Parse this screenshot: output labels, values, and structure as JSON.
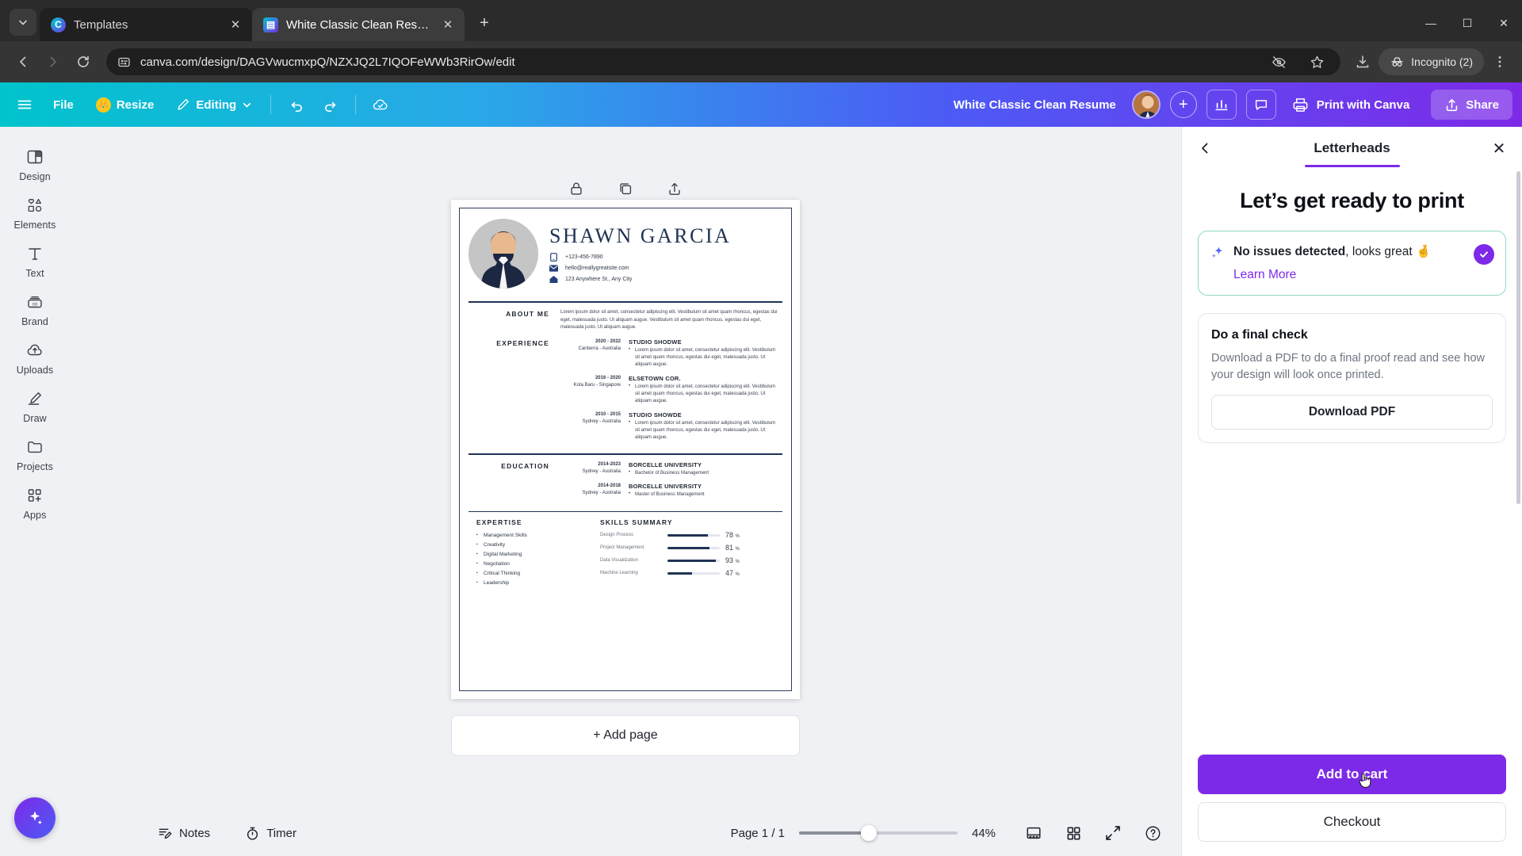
{
  "browser": {
    "tabs": [
      {
        "title": "Templates",
        "favicon": "canva-icon",
        "active": false
      },
      {
        "title": "White Classic Clean Resume - A",
        "favicon": "canva-doc-icon",
        "active": true
      }
    ],
    "url": "canva.com/design/DAGVwucmxpQ/NZXJQ2L7IQOFeWWb3RirOw/edit",
    "profile_label": "Incognito (2)",
    "new_tab_label": "+",
    "window": {
      "minimize": "—",
      "maximize": "☐",
      "close": "✕"
    }
  },
  "canva_header": {
    "file_label": "File",
    "resize_label": "Resize",
    "editing_label": "Editing",
    "doc_title": "White Classic Clean Resume",
    "print_label": "Print with Canva",
    "share_label": "Share",
    "plus_label": "+",
    "accent_purple": "#7d2ae8",
    "accent_teal": "#00c4cc"
  },
  "sidebar": {
    "items": [
      {
        "label": "Design",
        "icon": "design-icon"
      },
      {
        "label": "Elements",
        "icon": "elements-icon"
      },
      {
        "label": "Text",
        "icon": "text-icon"
      },
      {
        "label": "Brand",
        "icon": "brand-icon"
      },
      {
        "label": "Uploads",
        "icon": "uploads-icon"
      },
      {
        "label": "Draw",
        "icon": "draw-icon"
      },
      {
        "label": "Projects",
        "icon": "projects-icon"
      },
      {
        "label": "Apps",
        "icon": "apps-icon"
      }
    ]
  },
  "canvas": {
    "add_page_label": "+ Add page"
  },
  "bottom_bar": {
    "notes_label": "Notes",
    "timer_label": "Timer",
    "page_label": "Page 1 / 1",
    "zoom_value": "44%",
    "zoom_percent": 44
  },
  "right_panel": {
    "tab_label": "Letterheads",
    "title": "Let’s get ready to print",
    "status": {
      "bold": "No issues detected",
      "rest": ", looks great 🤞",
      "learn_more": "Learn More"
    },
    "final_check": {
      "title": "Do a final check",
      "description": "Download a PDF to do a final proof read and see how your design will look once printed.",
      "button": "Download PDF"
    },
    "add_to_cart": "Add to cart",
    "checkout": "Checkout"
  },
  "resume": {
    "name": "SHAWN GARCIA",
    "contacts": [
      {
        "icon": "phone-icon",
        "text": "+123-456-7890"
      },
      {
        "icon": "mail-icon",
        "text": "hello@reallygreatsite.com"
      },
      {
        "icon": "home-icon",
        "text": "123 Anywhere St., Any City"
      }
    ],
    "about": {
      "heading": "ABOUT ME",
      "body": "Lorem ipsum dolor sit amet, consectetur adipiscing elit. Vestibulum sit amet quam rhoncus, egestas dui eget, malesuada justo. Ut aliquam augue. Vestibulum sit amet quam rhoncus, egestas dui eget, malesuada justo. Ut aliquam augue."
    },
    "experience": {
      "heading": "EXPERIENCE",
      "jobs": [
        {
          "dates": "2020 - 2022",
          "place": "Canberra - Australia",
          "company": "STUDIO SHODWE",
          "bullets": [
            "Lorem ipsum dolor sit amet, consectetur adipiscing elit. Vestibulum sit amet quam rhoncus, egestas dui eget, malesuada justo. Ut aliquam augue."
          ]
        },
        {
          "dates": "2016 - 2020",
          "place": "Kota Baru - Singapore",
          "company": "ELSETOWN COR.",
          "bullets": [
            "Lorem ipsum dolor sit amet, consectetur adipiscing elit. Vestibulum sit amet quam rhoncus, egestas dui eget, malesuada justo. Ut aliquam augue."
          ]
        },
        {
          "dates": "2010 - 2015",
          "place": "Sydney - Australia",
          "company": "STUDIO SHOWDE",
          "bullets": [
            "Lorem ipsum dolor sit amet, consectetur adipiscing elit. Vestibulum sit amet quam rhoncus, egestas dui eget, malesuada justo. Ut aliquam augue."
          ]
        }
      ]
    },
    "education": {
      "heading": "EDUCATION",
      "entries": [
        {
          "dates": "2014-2023",
          "place": "Sydney - Australia",
          "school": "BORCELLE UNIVERSITY",
          "degree": "Bachelor of Business Management"
        },
        {
          "dates": "2014-2018",
          "place": "Sydney - Australia",
          "school": "BORCELLE UNIVERSITY",
          "degree": "Master of Business Management"
        }
      ]
    },
    "expertise": {
      "heading": "EXPERTISE",
      "items": [
        "Management Skills",
        "Creativity",
        "Digital Marketing",
        "Negotiation",
        "Critical Thinking",
        "Leadership"
      ]
    },
    "skills": {
      "heading": "SKILLS SUMMARY",
      "items": [
        {
          "name": "Design Process",
          "value": 78,
          "label": "78"
        },
        {
          "name": "Project Management",
          "value": 81,
          "label": "81"
        },
        {
          "name": "Data Visualization",
          "value": 93,
          "label": "93"
        },
        {
          "name": "Machine Learning",
          "value": 47,
          "label": "47"
        }
      ],
      "unit": "%"
    }
  }
}
